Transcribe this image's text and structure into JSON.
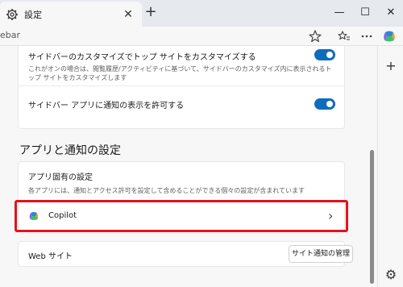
{
  "tab": {
    "title": "設定",
    "close_glyph": "✕",
    "new_tab_glyph": "+"
  },
  "window": {
    "minimize": "—",
    "maximize": "☐",
    "close": "✕"
  },
  "address": {
    "text": "ebar"
  },
  "settings": {
    "sidebar_customize": {
      "title": "サイドバーのカスタマイズでトップ サイトをカスタマイズする",
      "description": "これがオンの場合は、閲覧履歴/アクティビティに基づいて、サイドバーのカスタマイズ内に表示されるトップ サイトをカスタマイズします",
      "enabled": true
    },
    "sidebar_notifications": {
      "title": "サイドバー アプリに通知の表示を許可する",
      "enabled": true
    },
    "section_title": "アプリと通知の設定",
    "app_specific": {
      "title": "アプリ固有の設定",
      "description": "各アプリには、通知とアクセス許可を設定して含めることができる個々の設定が含まれています"
    },
    "copilot": {
      "label": "Copilot",
      "chevron": "›"
    },
    "web_sites": {
      "label": "Web サイト",
      "button": "サイト通知の管理"
    }
  },
  "sidebar": {
    "add_glyph": "+",
    "settings_glyph": "⚙"
  },
  "colors": {
    "accent": "#0f6cbd",
    "highlight": "#e0141e"
  }
}
